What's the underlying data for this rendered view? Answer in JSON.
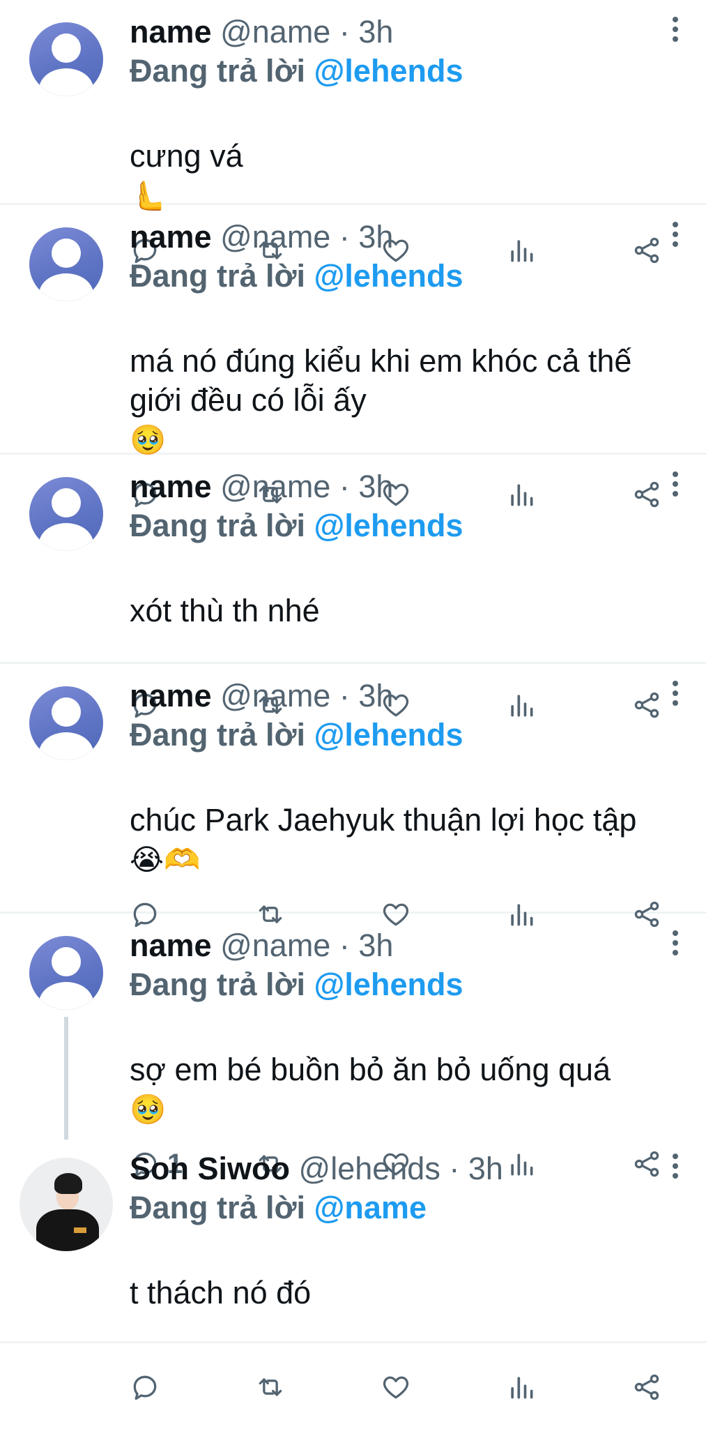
{
  "tweets": [
    {
      "name": "name",
      "handle": "@name",
      "time": "· 3h",
      "reply_label": "Đang trả lời",
      "reply_to": "@lehends",
      "text": "cưng vá",
      "emoji": "🫷",
      "reply_count": "",
      "avatar": "default-avatar"
    },
    {
      "name": "name",
      "handle": "@name",
      "time": "· 3h",
      "reply_label": "Đang trả lời",
      "reply_to": "@lehends",
      "text": "má nó đúng kiểu khi em khóc cả thế giới đều có lỗi ấy",
      "emoji": "🥹",
      "reply_count": "",
      "avatar": "default-avatar"
    },
    {
      "name": "name",
      "handle": "@name",
      "time": "· 3h",
      "reply_label": "Đang trả lời",
      "reply_to": "@lehends",
      "text": "xót thù th nhé",
      "emoji": "",
      "reply_count": "",
      "avatar": "default-avatar"
    },
    {
      "name": "name",
      "handle": "@name",
      "time": "· 3h",
      "reply_label": "Đang trả lời",
      "reply_to": "@lehends",
      "text": "chúc Park Jaehyuk thuận lợi học tập",
      "emoji": "😭🫶",
      "reply_count": "",
      "avatar": "default-avatar"
    },
    {
      "name": "name",
      "handle": "@name",
      "time": "· 3h",
      "reply_label": "Đang trả lời",
      "reply_to": "@lehends",
      "text": "sợ em bé buồn bỏ ăn bỏ uống quá",
      "emoji": "🥹",
      "reply_count": "1",
      "avatar": "default-avatar"
    },
    {
      "name": "Son Siwoo",
      "handle": "@lehends",
      "time": "· 3h",
      "reply_label": "Đang trả lời",
      "reply_to": "@name",
      "text": "t thách nó đó",
      "emoji": "",
      "reply_count": "",
      "avatar": "profile-photo"
    }
  ],
  "icons": {
    "reply": "reply-icon",
    "retweet": "retweet-icon",
    "like": "heart-icon",
    "views": "views-icon",
    "share": "share-icon",
    "more": "more-icon"
  },
  "colors": {
    "accent": "#1d9bf0",
    "muted": "#536471",
    "text": "#0f1419",
    "divider": "#eff3f4"
  }
}
